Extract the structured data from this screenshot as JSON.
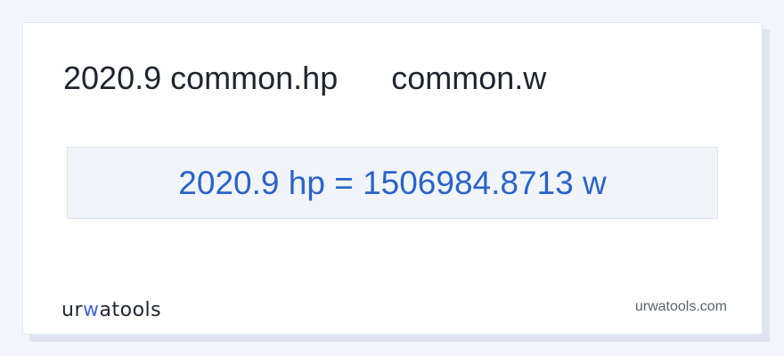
{
  "header": {
    "from_value": "2020.9",
    "from_unit": "common.hp",
    "to_unit": "common.w"
  },
  "result": {
    "text": "2020.9 hp = 1506984.8713 w"
  },
  "footer": {
    "logo_part1": "ur",
    "logo_accent": "w",
    "logo_part2": "atools",
    "site": "urwatools.com"
  },
  "colors": {
    "accent": "#2a64c9",
    "logo_accent": "#3f67d8",
    "result_bg": "#f1f4f8"
  }
}
